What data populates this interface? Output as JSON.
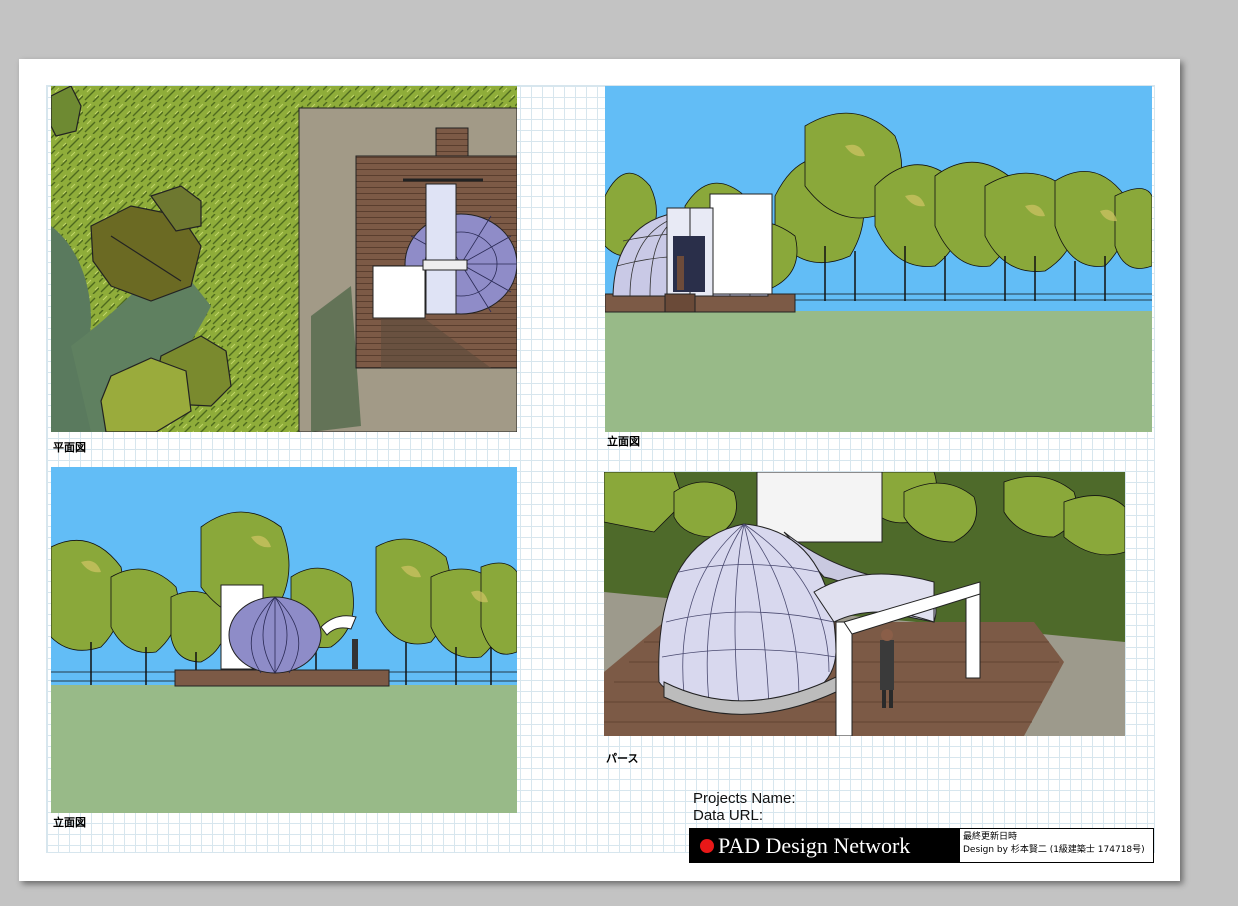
{
  "captions": {
    "plan": "平面図",
    "elevation_right": "立面図",
    "elevation_left": "立面図",
    "perspective": "パース"
  },
  "project": {
    "name_label": "Projects Name:",
    "url_label": "Data URL:"
  },
  "title_block": {
    "brand": "PAD Design Network",
    "last_updated_label": "最終更新日時",
    "design_by": "Design by 杉本賢二 (1級建築士 174718号)"
  },
  "colors": {
    "sky": "#62bdf6",
    "lawn": "#98ba88",
    "foliage": "#8fad3a",
    "deck": "#7c5a46",
    "brand_dot": "#e81818"
  }
}
